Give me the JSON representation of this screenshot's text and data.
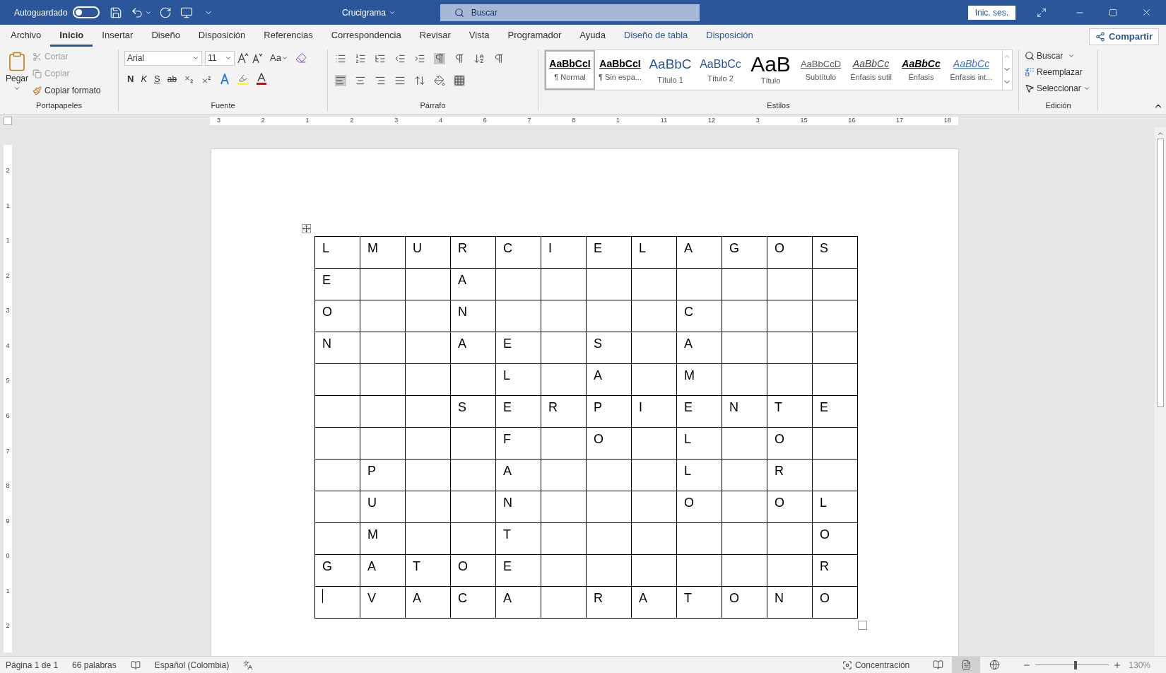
{
  "title_bar": {
    "autosave_label": "Autoguardado",
    "autosave_on": false,
    "document_title": "Crucigrama",
    "search_placeholder": "Buscar",
    "sign_in": "Inic. ses."
  },
  "tabs": [
    {
      "label": "Archivo",
      "selected": false,
      "kind": "normal"
    },
    {
      "label": "Inicio",
      "selected": true,
      "kind": "normal"
    },
    {
      "label": "Insertar",
      "selected": false,
      "kind": "normal"
    },
    {
      "label": "Diseño",
      "selected": false,
      "kind": "normal"
    },
    {
      "label": "Disposición",
      "selected": false,
      "kind": "normal"
    },
    {
      "label": "Referencias",
      "selected": false,
      "kind": "normal"
    },
    {
      "label": "Correspondencia",
      "selected": false,
      "kind": "normal"
    },
    {
      "label": "Revisar",
      "selected": false,
      "kind": "normal"
    },
    {
      "label": "Vista",
      "selected": false,
      "kind": "normal"
    },
    {
      "label": "Programador",
      "selected": false,
      "kind": "normal"
    },
    {
      "label": "Ayuda",
      "selected": false,
      "kind": "normal"
    },
    {
      "label": "Diseño de tabla",
      "selected": false,
      "kind": "contextual"
    },
    {
      "label": "Disposición",
      "selected": false,
      "kind": "contextual"
    }
  ],
  "share_button": "Compartir",
  "clipboard": {
    "paste": "Pegar",
    "cut": "Cortar",
    "copy": "Copiar",
    "format_painter": "Copiar formato",
    "group": "Portapapeles"
  },
  "font": {
    "family": "Arial",
    "size": "11",
    "change_case": "Aa",
    "bold": "N",
    "italic": "K",
    "underline": "S",
    "strike": "ab",
    "group": "Fuente"
  },
  "paragraph": {
    "group": "Párrafo"
  },
  "styles": {
    "items": [
      {
        "preview": "AaBbCcI",
        "name": "¶ Normal",
        "selected": true,
        "kind": "normal"
      },
      {
        "preview": "AaBbCcI",
        "name": "¶ Sin espa...",
        "selected": false,
        "kind": "nospacing"
      },
      {
        "preview": "AaBbC",
        "name": "Título 1",
        "selected": false,
        "kind": "heading1"
      },
      {
        "preview": "AaBbCc",
        "name": "Título 2",
        "selected": false,
        "kind": "heading2"
      },
      {
        "preview": "AaB",
        "name": "Título",
        "selected": false,
        "kind": "title"
      },
      {
        "preview": "AaBbCcD",
        "name": "Subtítulo",
        "selected": false,
        "kind": "subtitle"
      },
      {
        "preview": "AaBbCc",
        "name": "Énfasis sutil",
        "selected": false,
        "kind": "subtle"
      },
      {
        "preview": "AaBbCc",
        "name": "Énfasis",
        "selected": false,
        "kind": "emphasis"
      },
      {
        "preview": "AaBbCc",
        "name": "Énfasis int...",
        "selected": false,
        "kind": "intense"
      }
    ],
    "group": "Estilos"
  },
  "editing": {
    "find": "Buscar",
    "replace": "Reemplazar",
    "select": "Seleccionar",
    "group": "Edición"
  },
  "ruler": {
    "labels": [
      "3",
      "2",
      "1",
      "2",
      "3",
      "4",
      "6",
      "7",
      "8",
      "1",
      "11",
      "12",
      "3",
      "15",
      "16",
      "17",
      "18"
    ]
  },
  "vertical_ruler": {
    "labels": [
      "2",
      "1",
      "1",
      "2",
      "3",
      "4",
      "5",
      "6",
      "7",
      "8",
      "9",
      "0",
      "1",
      "2"
    ]
  },
  "crossword": {
    "rows": [
      [
        "L",
        "M",
        "U",
        "R",
        "C",
        "I",
        "E",
        "L",
        "A",
        "G",
        "O",
        "S"
      ],
      [
        "E",
        "",
        "",
        "A",
        "",
        "",
        "",
        "",
        "",
        "",
        "",
        ""
      ],
      [
        "O",
        "",
        "",
        "N",
        "",
        "",
        "",
        "",
        "C",
        "",
        "",
        ""
      ],
      [
        "N",
        "",
        "",
        "A",
        "E",
        "",
        "S",
        "",
        "A",
        "",
        "",
        ""
      ],
      [
        "",
        "",
        "",
        "",
        "L",
        "",
        "A",
        "",
        "M",
        "",
        "",
        ""
      ],
      [
        "",
        "",
        "",
        "S",
        "E",
        "R",
        "P",
        "I",
        "E",
        "N",
        "T",
        "E"
      ],
      [
        "",
        "",
        "",
        "",
        "F",
        "",
        "O",
        "",
        "L",
        "",
        "O",
        ""
      ],
      [
        "",
        "P",
        "",
        "",
        "A",
        "",
        "",
        "",
        "L",
        "",
        "R",
        ""
      ],
      [
        "",
        "U",
        "",
        "",
        "N",
        "",
        "",
        "",
        "O",
        "",
        "O",
        "L"
      ],
      [
        "",
        "M",
        "",
        "",
        "T",
        "",
        "",
        "",
        "",
        "",
        "",
        "O"
      ],
      [
        "G",
        "A",
        "T",
        "O",
        "E",
        "",
        "",
        "",
        "",
        "",
        "",
        "R"
      ],
      [
        "",
        "V",
        "A",
        "C",
        "A",
        "",
        "R",
        "A",
        "T",
        "O",
        "N",
        "O"
      ]
    ]
  },
  "status_bar": {
    "page": "Página 1 de 1",
    "words": "66 palabras",
    "language": "Español (Colombia)",
    "focus": "Concentración",
    "zoom": "130%",
    "zoom_slider": {
      "level": 0.55
    },
    "views": [
      {
        "kind": "read",
        "selected": false
      },
      {
        "kind": "print",
        "selected": true
      },
      {
        "kind": "web",
        "selected": false
      }
    ]
  }
}
